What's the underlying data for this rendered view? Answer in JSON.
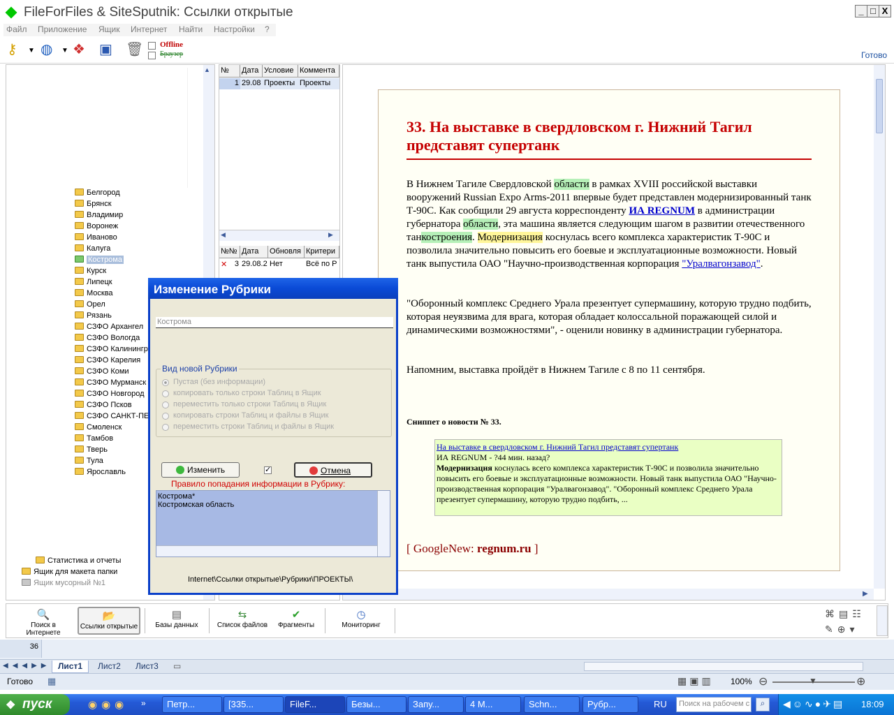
{
  "window": {
    "title": "FileForFiles & SiteSputnik: Ссылки открытые",
    "min": "_",
    "max": "□",
    "close": "X"
  },
  "menu": [
    "Файл",
    "Приложение",
    "Ящик",
    "Интернет",
    "Найти",
    "Настройки",
    "?"
  ],
  "toolbar": {
    "offline": "Offline",
    "browser": "Браузер",
    "status": "Готово"
  },
  "tree": {
    "items": [
      "Белгород",
      "Брянск",
      "Владимир",
      "Воронеж",
      "Иваново",
      "Калуга",
      "Кострома",
      "Курск",
      "Липецк",
      "Москва",
      "Орел",
      "Рязань",
      "СЗФО Архангел",
      "СЗФО Вологда",
      "СЗФО Калинингр",
      "СЗФО Карелия",
      "СЗФО Коми",
      "СЗФО Мурманск",
      "СЗФО Новгород",
      "СЗФО Псков",
      "СЗФО САНКТ-ПЕ",
      "Смоленск",
      "Тамбов",
      "Тверь",
      "Тула",
      "Ярославль"
    ],
    "selected": "Кострома",
    "bottom_items": [
      "Статистика и отчеты",
      "Ящик для  макета папки",
      "Ящик мусорный №1"
    ]
  },
  "grid1": {
    "headers": [
      "№",
      "Дата",
      "Условие",
      "Коммента"
    ],
    "row": [
      "1",
      "29.08",
      "Проекты",
      "Проекты"
    ]
  },
  "grid2": {
    "headers": [
      "№№",
      "Дата",
      "Обновля",
      "Критери"
    ],
    "row": [
      "3",
      "29.08.2",
      "Нет",
      "Всё по Р"
    ]
  },
  "article": {
    "title": "33. На выставке в свердловском г. Нижний Тагил представят супертанк",
    "p1_a": "В Нижнем Тагиле Свердловской ",
    "p1_hl1": "области",
    "p1_b": " в рамках XVIII российской выставки вооружений Russian Expo Arms-2011 впервые будет представлен модернизированный танк Т-90С. Как сообщили 29 августа корреспонденту ",
    "p1_link": "ИА REGNUM",
    "p1_c": " в администрации губернатора ",
    "p1_hl2": "области",
    "p1_d": ", эта машина является следующим шагом в развитии отечественного тан",
    "p1_hl3": "костроения",
    "p1_e": ". ",
    "p1_hl4": "Модернизация",
    "p1_f": " коснулась всего комплекса характеристик Т-90С и позволила значительно повысить его боевые и эксплуатационные возможности. Новый танк выпустила ОАО \"Научно-производственная корпорация ",
    "p1_link2": "\"Уралвагонзавод\"",
    "p1_g": ".",
    "p2": "\"Оборонный комплекс Среднего Урала презентует супермашину, которую трудно подбить, которая неуязвима для врага, которая обладает колоссальной поражающей силой и динамическими возможностями\", - оценили новинку в администрации губернатора.",
    "p3": "Напомним, выставка пройдёт в Нижнем Тагиле с 8 по 11 сентября.",
    "snippet_title": "Сниппет о новости № 33.",
    "snippet_link": "На выставке в свердловском г. Нижний Тагил представят супертанк",
    "snippet_src": "ИА REGNUM - ?44 мин. назад?",
    "snippet_bold": "Модернизация",
    "snippet_text": " коснулась всего комплекса характеристик Т-90С и позволила значительно повысить его боевые и эксплуатационные возможности. Новый танк выпустила ОАО \"Научно-производственная корпорация \"Уралвагонзавод\". \"Оборонный комплекс Среднего Урала презентует супермашину, которую трудно подбить, ...",
    "gnews_a": "[ GoogleNew: ",
    "gnews_b": "regnum.ru",
    "gnews_c": " ]"
  },
  "tabs": [
    "Поиск в Интернете",
    "Ссылки открытые",
    "Базы данных",
    "Список файлов",
    "Фрагменты",
    "Мониторинг"
  ],
  "excel": {
    "row_num": "36",
    "sheets": [
      "Лист1",
      "Лист2",
      "Лист3"
    ],
    "status": "Готово",
    "zoom": "100%"
  },
  "dialog": {
    "title": "Изменение Рубрики",
    "input_value": "Кострома",
    "group_title": "Вид новой Рубрики",
    "options": [
      "Пустая (без информации)",
      "копировать   только строки Таблиц в Ящик",
      "переместить только строки Таблиц в Ящик",
      "копировать   строки Таблиц и файлы в Ящик",
      "переместить строки Таблиц и файлы в Ящик"
    ],
    "btn_change": "Изменить",
    "btn_cancel": "Отмена",
    "rule_label": "Правило попадания информации в Рубрику:",
    "rule_lines": [
      "Кострома*",
      "Костромская область"
    ],
    "path": "Internet\\Ссылки открытые\\Рубрики\\ПРОЕКТЫ\\"
  },
  "taskbar": {
    "start": "пуск",
    "tasks": [
      "Петр...",
      "[335...",
      "FileF...",
      "Безы...",
      "Запу...",
      "4 М...",
      "Schn...",
      "Рубр..."
    ],
    "lang": "RU",
    "search_placeholder": "Поиск на рабочем с",
    "clock": "18:09"
  }
}
